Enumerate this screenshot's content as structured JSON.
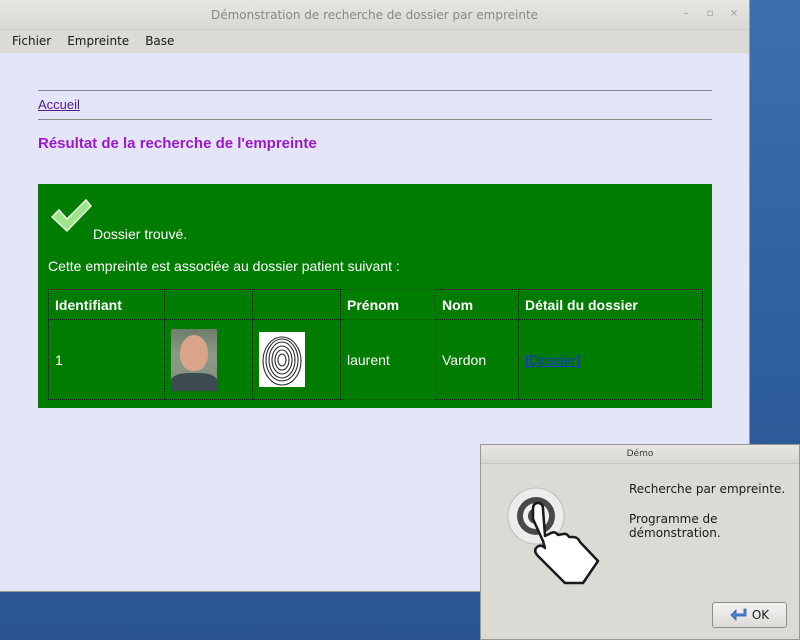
{
  "window": {
    "title": "Démonstration de recherche de dossier par empreinte",
    "controls": [
      "–",
      "▫",
      "×"
    ]
  },
  "menu": [
    "Fichier",
    "Empreinte",
    "Base"
  ],
  "page": {
    "home_link": "Accueil",
    "heading": "Résultat de la recherche de l'empreinte"
  },
  "result": {
    "status": "Dossier trouvé.",
    "message": "Cette empreinte est associée au dossier patient suivant :",
    "columns": [
      "Identifiant",
      "",
      "",
      "Prénom",
      "Nom",
      "Détail du dossier"
    ],
    "rows": [
      {
        "id": "1",
        "photo": "patient-photo",
        "fingerprint": "fingerprint-image",
        "prenom": "laurent",
        "nom": "Vardon",
        "link": "[Dossier]"
      }
    ]
  },
  "dialog": {
    "title": "Démo",
    "line1": "Recherche par empreinte.",
    "line2": "Programme de démonstration.",
    "ok_label": "OK"
  },
  "colors": {
    "result_bg": "#007d00",
    "heading": "#9a19c8",
    "content_bg": "#e5e5f9"
  }
}
